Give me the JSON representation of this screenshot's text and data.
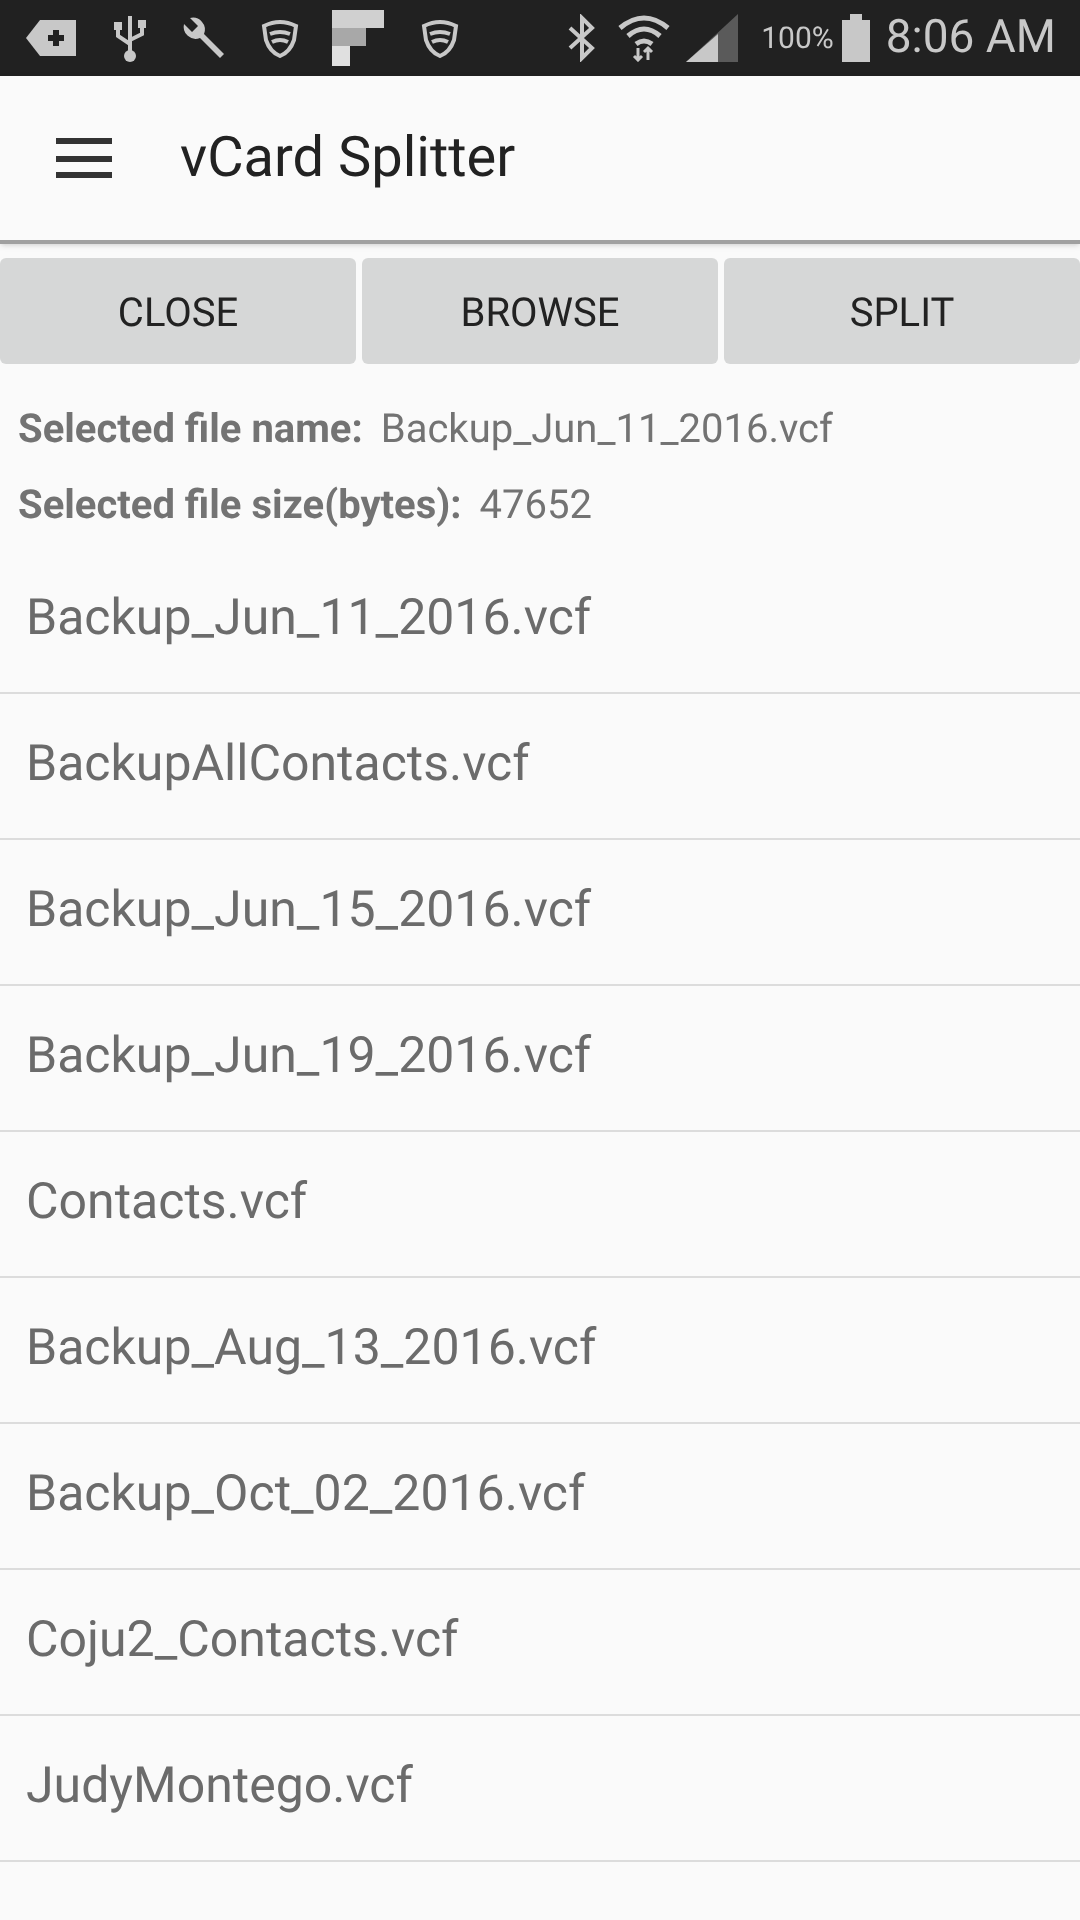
{
  "status_bar": {
    "battery": "100%",
    "time": "8:06 AM"
  },
  "app_bar": {
    "title": "vCard Splitter"
  },
  "buttons": [
    {
      "label": "CLOSE"
    },
    {
      "label": "BROWSE"
    },
    {
      "label": "SPLIT"
    }
  ],
  "selected_file": {
    "name_label": "Selected file name:",
    "name": "Backup_Jun_11_2016.vcf",
    "size_label": "Selected file size(bytes):",
    "size": "47652"
  },
  "files": [
    "Backup_Jun_11_2016.vcf",
    "BackupAllContacts.vcf",
    "Backup_Jun_15_2016.vcf",
    "Backup_Jun_19_2016.vcf",
    "Contacts.vcf",
    "Backup_Aug_13_2016.vcf",
    "Backup_Oct_02_2016.vcf",
    "Coju2_Contacts.vcf",
    "JudyMontego.vcf"
  ]
}
